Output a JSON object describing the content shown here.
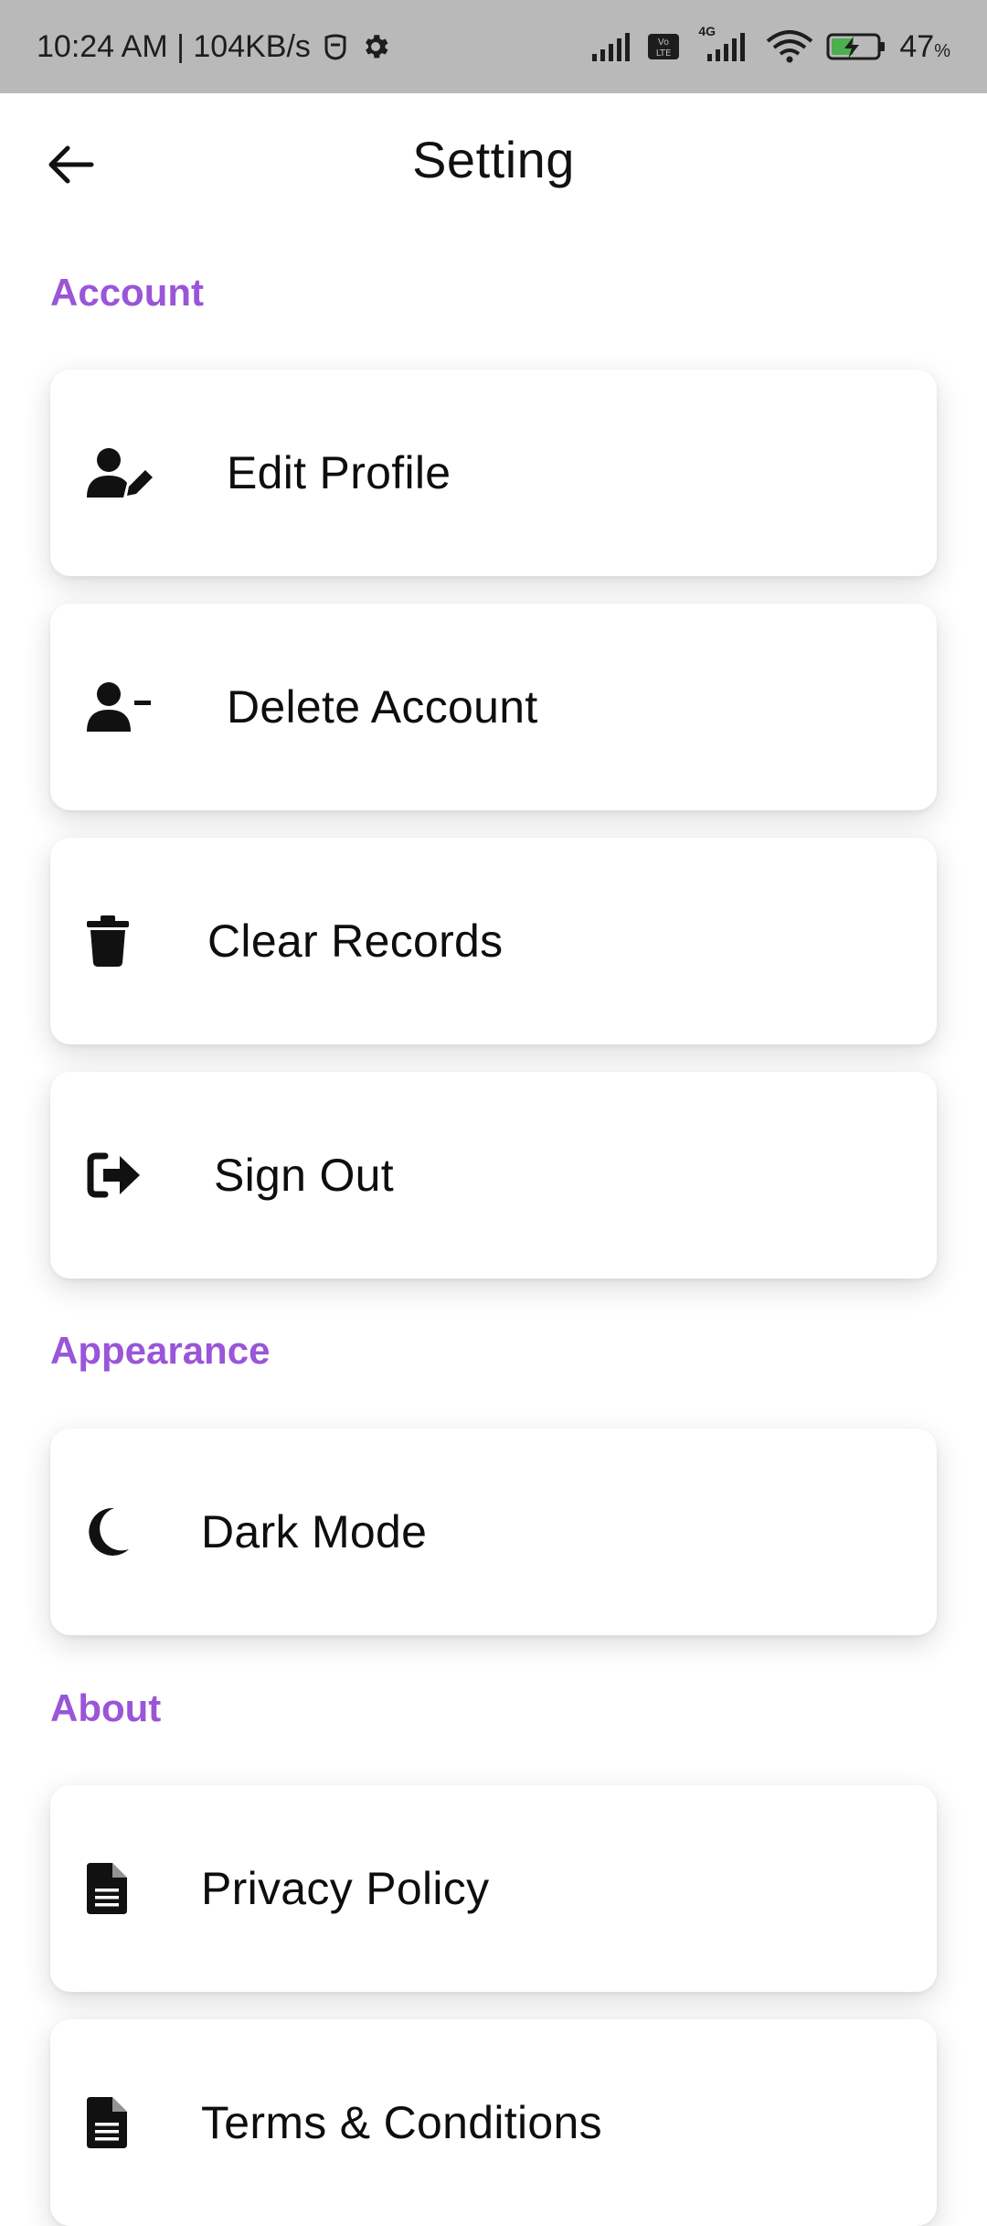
{
  "status_bar": {
    "time_speed": "10:24 AM | 104KB/s",
    "network_small": "4G",
    "battery_pct": "47",
    "battery_unit": "%"
  },
  "header": {
    "title": "Setting",
    "back_icon": "arrow-left-icon"
  },
  "sections": {
    "account": {
      "title": "Account",
      "items": [
        {
          "label": "Edit Profile",
          "icon": "user-edit-icon"
        },
        {
          "label": "Delete Account",
          "icon": "user-minus-icon"
        },
        {
          "label": "Clear Records",
          "icon": "trash-icon"
        },
        {
          "label": "Sign Out",
          "icon": "sign-out-icon"
        }
      ]
    },
    "appearance": {
      "title": "Appearance",
      "items": [
        {
          "label": "Dark Mode",
          "icon": "moon-icon"
        }
      ]
    },
    "about": {
      "title": "About",
      "items": [
        {
          "label": "Privacy Policy",
          "icon": "document-icon"
        },
        {
          "label": "Terms & Conditions",
          "icon": "document-icon"
        }
      ]
    }
  },
  "colors": {
    "accent": "#9a55d8",
    "status_bar_bg": "#b9b9b9",
    "card_bg": "#ffffff",
    "text": "#111111"
  }
}
